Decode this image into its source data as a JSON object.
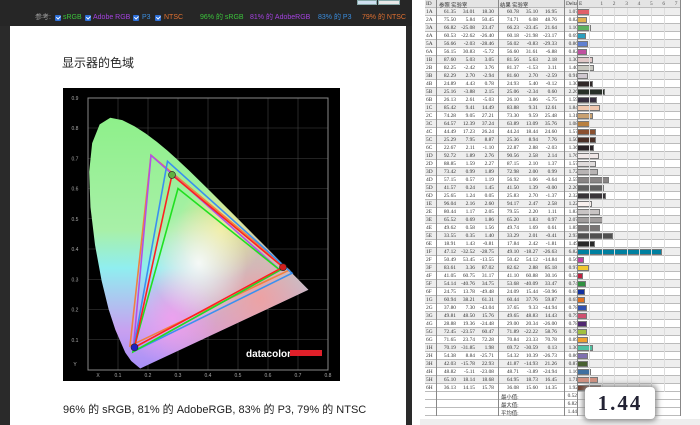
{
  "legend": {
    "prefix": "参考:",
    "items": [
      {
        "label": "sRGB",
        "color": "#3cc43c",
        "checked": true
      },
      {
        "label": "Adobe RGB",
        "color": "#a442e0",
        "checked": true
      },
      {
        "label": "P3",
        "color": "#3a8ee0",
        "checked": true
      },
      {
        "label": "NTSC",
        "color": "#e07030",
        "checked": true
      }
    ],
    "coverage": [
      {
        "label": "96% 的 sRGB",
        "color": "#3cc43c"
      },
      {
        "label": "81% 的 AdobeRGB",
        "color": "#a442e0"
      },
      {
        "label": "83% 的 P3",
        "color": "#3a8ee0"
      },
      {
        "label": "79% 的 NTSC",
        "color": "#e07030"
      }
    ]
  },
  "title": "显示器的色域",
  "caption": "96% 的 sRGB, 81% 的 AdobeRGB, 83% 的 P3, 79% 的 NTSC",
  "chart": {
    "type": "cie-xy-gamut",
    "x_ticks": [
      "X",
      "0.1",
      "0.2",
      "0.3",
      "0.4",
      "0.5",
      "0.6",
      "0.7",
      "0.8"
    ],
    "y_ticks": [
      "Y",
      "0.1",
      "0.2",
      "0.3",
      "0.4",
      "0.5",
      "0.6",
      "0.7",
      "0.8",
      "0.9"
    ],
    "gamuts": [
      {
        "name": "NTSC",
        "color": "#f08040",
        "points": [
          [
            0.67,
            0.33
          ],
          [
            0.21,
            0.71
          ],
          [
            0.14,
            0.08
          ]
        ]
      },
      {
        "name": "Adobe RGB",
        "color": "#b050e8",
        "points": [
          [
            0.64,
            0.33
          ],
          [
            0.21,
            0.71
          ],
          [
            0.15,
            0.06
          ]
        ]
      },
      {
        "name": "P3",
        "color": "#3a90f0",
        "points": [
          [
            0.68,
            0.32
          ],
          [
            0.265,
            0.69
          ],
          [
            0.15,
            0.06
          ]
        ]
      },
      {
        "name": "sRGB",
        "color": "#20e020",
        "points": [
          [
            0.64,
            0.33
          ],
          [
            0.3,
            0.6
          ],
          [
            0.15,
            0.06
          ]
        ]
      },
      {
        "name": "Measured",
        "color": "#ff2020",
        "points": [
          [
            0.65,
            0.34
          ],
          [
            0.28,
            0.645
          ],
          [
            0.155,
            0.075
          ]
        ]
      }
    ],
    "logo": "datacolor"
  },
  "table": {
    "headers": [
      "ID",
      "参照 实验室",
      "结果 实验室",
      "Delta E"
    ],
    "axis_ticks": [
      "1",
      "2",
      "3",
      "4",
      "5",
      "6",
      "7"
    ],
    "rows": [
      [
        "1A",
        "61.35",
        "34.01",
        "18.30",
        "60.78",
        "35.10",
        "16.95",
        "1.07",
        "#e0606a"
      ],
      [
        "2A",
        "75.50",
        "5.84",
        "50.45",
        "74.71",
        "6.08",
        "48.76",
        "0.82",
        "#e0b050"
      ],
      [
        "3A",
        "66.82",
        "-25.08",
        "23.47",
        "66.23",
        "-23.45",
        "21.64",
        "1.10",
        "#5cb060"
      ],
      [
        "4A",
        "60.53",
        "-22.62",
        "-26.40",
        "60.18",
        "-21.98",
        "-23.17",
        "0.69",
        "#2aa0c0"
      ],
      [
        "5A",
        "56.66",
        "-2.03",
        "-28.46",
        "56.02",
        "-0.83",
        "-29.33",
        "0.86",
        "#6080d0"
      ],
      [
        "6A",
        "56.15",
        "30.83",
        "-5.72",
        "56.60",
        "31.61",
        "-6.88",
        "0.82",
        "#c050a0"
      ],
      [
        "1B",
        "87.60",
        "5.03",
        "3.05",
        "81.56",
        "5.63",
        "2.18",
        "1.30",
        "#e0c8c8"
      ],
      [
        "2B",
        "82.25",
        "-2.42",
        "3.76",
        "81.37",
        "-1.53",
        "3.11",
        "1.40",
        "#c8c8c0"
      ],
      [
        "3B",
        "82.29",
        "2.70",
        "-2.94",
        "81.60",
        "2.70",
        "-2.59",
        "0.91",
        "#d0c8d0"
      ],
      [
        "4B",
        "24.89",
        "4.43",
        "0.78",
        "24.93",
        "5.40",
        "-0.12",
        "1.30",
        "#302828"
      ],
      [
        "5B",
        "25.16",
        "-3.88",
        "2.15",
        "25.06",
        "-2.34",
        "0.60",
        "2.26",
        "#283028"
      ],
      [
        "6B",
        "26.13",
        "2.61",
        "-5.03",
        "26.10",
        "3.86",
        "-5.75",
        "1.59",
        "#383040"
      ],
      [
        "1C",
        "85.42",
        "9.41",
        "14.49",
        "83.88",
        "9.31",
        "12.61",
        "1.84",
        "#f0c8b0"
      ],
      [
        "2C",
        "74.28",
        "9.05",
        "27.21",
        "73.30",
        "9.59",
        "25.48",
        "1.31",
        "#c8a070"
      ],
      [
        "3C",
        "64.57",
        "12.39",
        "37.24",
        "63.89",
        "13.09",
        "35.76",
        "1.08",
        "#b88040"
      ],
      [
        "4C",
        "44.49",
        "17.23",
        "26.24",
        "44.24",
        "18.44",
        "24.60",
        "1.57",
        "#8a5030"
      ],
      [
        "5C",
        "25.29",
        "7.95",
        "8.87",
        "25.36",
        "8.94",
        "7.76",
        "1.50",
        "#4a3028"
      ],
      [
        "6C",
        "22.67",
        "2.11",
        "-1.10",
        "22.87",
        "2.88",
        "-2.03",
        "1.36",
        "#2a2428"
      ],
      [
        "1D",
        "92.72",
        "1.89",
        "2.76",
        "90.56",
        "2.58",
        "2.14",
        "1.76",
        "#f0e8e8"
      ],
      [
        "2D",
        "88.85",
        "1.59",
        "2.27",
        "87.15",
        "2.10",
        "1.37",
        "1.57",
        "#e0dcdc"
      ],
      [
        "3D",
        "73.42",
        "0.99",
        "1.89",
        "72.98",
        "2.00",
        "0.99",
        "1.72",
        "#b8b4b4"
      ],
      [
        "4D",
        "57.15",
        "0.57",
        "1.19",
        "56.92",
        "1.06",
        "-0.64",
        "2.55",
        "#888484"
      ],
      [
        "5D",
        "41.57",
        "0.24",
        "1.45",
        "41.50",
        "1.39",
        "-0.00",
        "2.20",
        "#606060"
      ],
      [
        "6D",
        "25.65",
        "1.24",
        "0.05",
        "25.83",
        "2.70",
        "-1.37",
        "2.32",
        "#383438"
      ],
      [
        "1E",
        "96.04",
        "2.16",
        "2.60",
        "94.17",
        "2.47",
        "2.58",
        "1.22",
        "#f8f0ee"
      ],
      [
        "2E",
        "80.44",
        "1.17",
        "2.05",
        "79.55",
        "2.20",
        "1.11",
        "1.83",
        "#c8c4c4"
      ],
      [
        "3E",
        "65.52",
        "0.69",
        "1.86",
        "65.20",
        "1.83",
        "0.97",
        "2.07",
        "#a09c9c"
      ],
      [
        "4E",
        "49.62",
        "0.58",
        "1.56",
        "49.74",
        "1.69",
        "0.61",
        "1.85",
        "#787474"
      ],
      [
        "5E",
        "33.55",
        "0.35",
        "1.40",
        "33.29",
        "2.01",
        "-0.41",
        "2.93",
        "#505050"
      ],
      [
        "6E",
        "18.91",
        "1.43",
        "-0.81",
        "17.84",
        "2.42",
        "-1.81",
        "1.49",
        "#282828"
      ],
      [
        "1F",
        "47.12",
        "-32.52",
        "-28.75",
        "49.10",
        "-18.27",
        "-26.63",
        "6.82",
        "#0080a0"
      ],
      [
        "2F",
        "50.49",
        "53.45",
        "-13.55",
        "50.42",
        "54.12",
        "-14.84",
        "0.56",
        "#c040a0"
      ],
      [
        "3F",
        "83.61",
        "3.36",
        "87.02",
        "82.62",
        "2.88",
        "85.18",
        "0.97",
        "#f0c830"
      ],
      [
        "4F",
        "41.05",
        "60.75",
        "31.17",
        "41.10",
        "60.88",
        "30.16",
        "0.52",
        "#c02040"
      ],
      [
        "5F",
        "54.14",
        "-40.76",
        "34.75",
        "53.68",
        "-40.09",
        "33.47",
        "0.74",
        "#309040"
      ],
      [
        "6F",
        "24.75",
        "13.78",
        "-49.48",
        "24.09",
        "15.44",
        "-50.96",
        "0.65",
        "#1030a0"
      ],
      [
        "1G",
        "60.94",
        "38.21",
        "61.31",
        "60.44",
        "37.76",
        "59.87",
        "0.65",
        "#e07020"
      ],
      [
        "2G",
        "37.80",
        "7.30",
        "-43.04",
        "37.65",
        "9.33",
        "-44.94",
        "0.78",
        "#3050b0"
      ],
      [
        "3G",
        "49.81",
        "48.50",
        "15.76",
        "49.65",
        "48.83",
        "14.43",
        "0.79",
        "#d05070"
      ],
      [
        "4G",
        "28.88",
        "19.36",
        "-24.48",
        "29.00",
        "20.34",
        "-26.00",
        "0.78",
        "#502870"
      ],
      [
        "5G",
        "72.45",
        "-23.57",
        "60.47",
        "71.89",
        "-22.22",
        "58.76",
        "0.79",
        "#a0c040"
      ],
      [
        "6G",
        "71.65",
        "23.74",
        "72.28",
        "70.84",
        "23.33",
        "70.78",
        "0.89",
        "#f0a030"
      ],
      [
        "1H",
        "70.19",
        "-31.85",
        "1.98",
        "69.72",
        "-30.59",
        "0.13",
        "1.30",
        "#50c0a0"
      ],
      [
        "2H",
        "54.38",
        "8.84",
        "-25.71",
        "54.32",
        "10.39",
        "-26.73",
        "0.86",
        "#8070b0"
      ],
      [
        "3H",
        "42.03",
        "-15.78",
        "22.93",
        "41.87",
        "-14.93",
        "21.26",
        "0.87",
        "#486030"
      ],
      [
        "4H",
        "48.82",
        "-5.11",
        "-23.08",
        "48.71",
        "-3.89",
        "-24.94",
        "1.16",
        "#4070a0"
      ],
      [
        "5H",
        "65.10",
        "18.14",
        "18.68",
        "64.95",
        "18.73",
        "16.45",
        "1.71",
        "#d09080"
      ],
      [
        "6H",
        "36.13",
        "14.15",
        "15.78",
        "36.08",
        "15.60",
        "14.35",
        "1.92",
        "#704030"
      ]
    ],
    "summary": [
      {
        "label": "最小值:",
        "value": "0.52"
      },
      {
        "label": "最大值:",
        "value": "6.82"
      },
      {
        "label": "平均值:",
        "value": "1.44"
      }
    ],
    "average_callout": "1.44"
  }
}
